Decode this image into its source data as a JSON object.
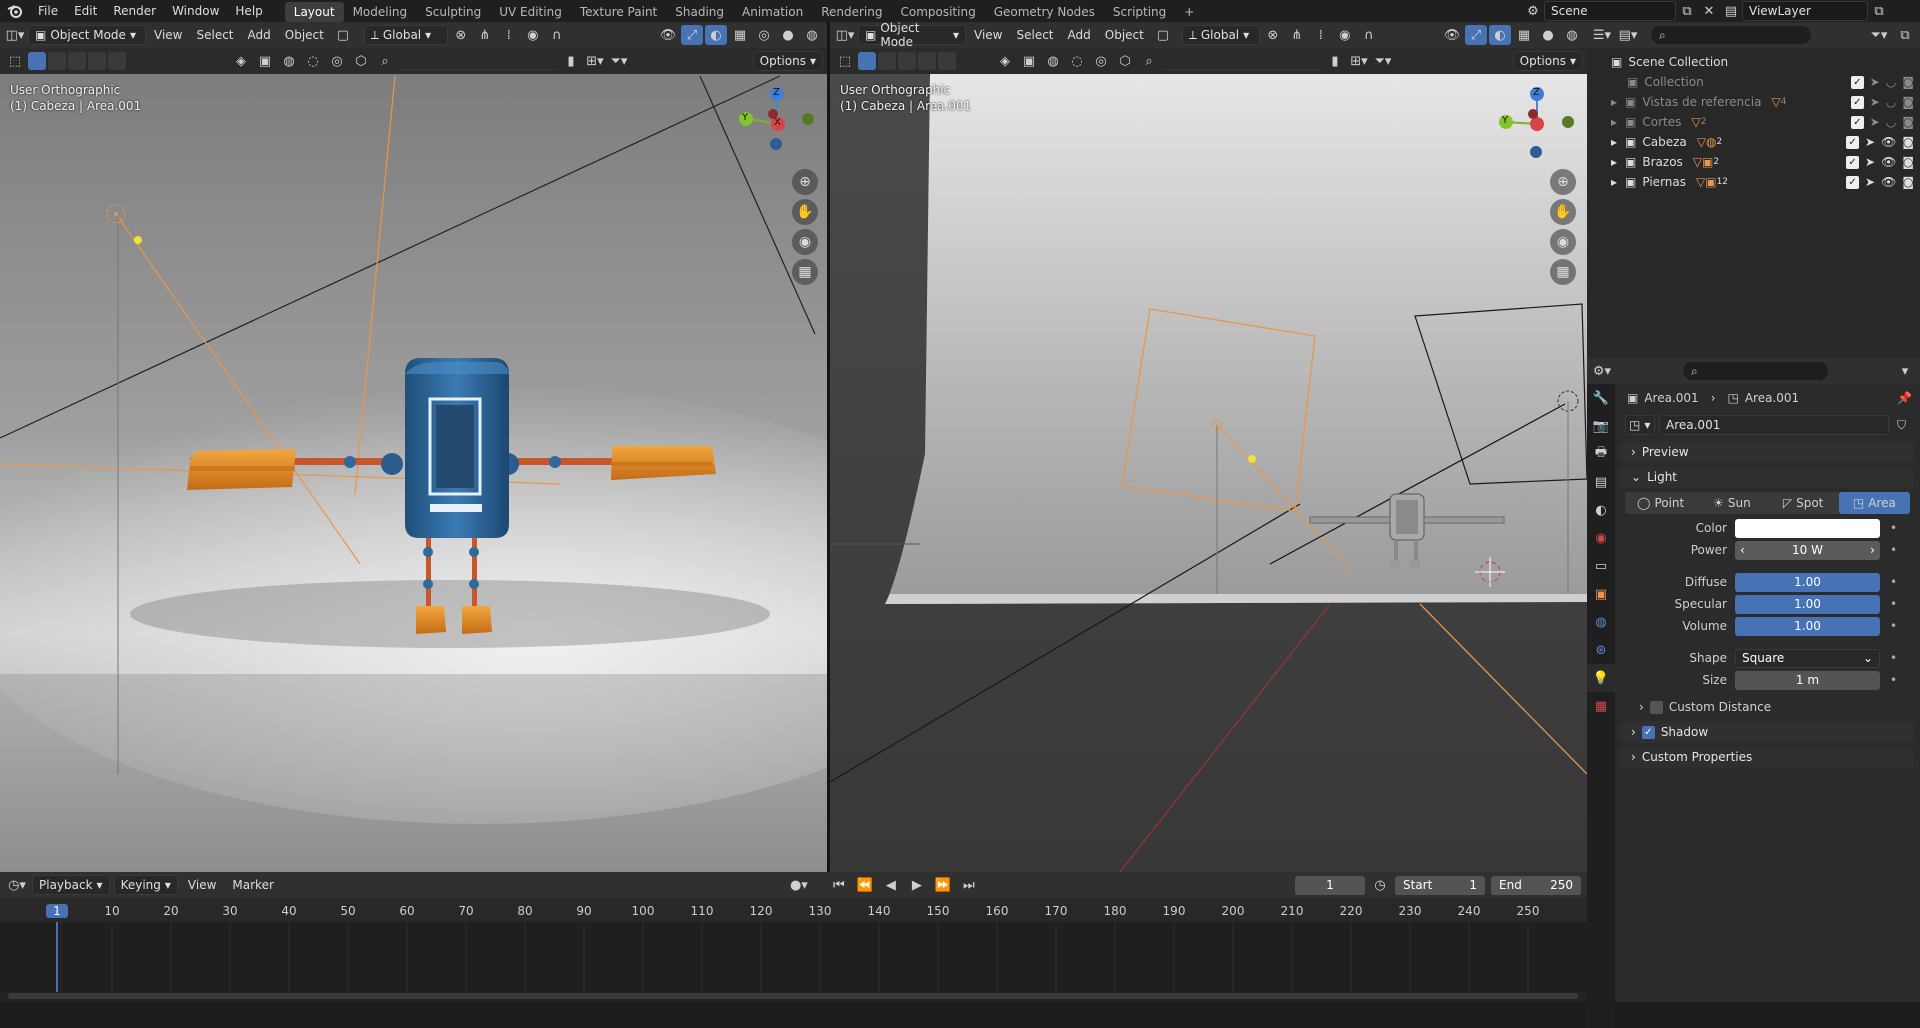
{
  "topbar": {
    "menus": [
      "File",
      "Edit",
      "Render",
      "Window",
      "Help"
    ],
    "workspaces": [
      "Layout",
      "Modeling",
      "Sculpting",
      "UV Editing",
      "Texture Paint",
      "Shading",
      "Animation",
      "Rendering",
      "Compositing",
      "Geometry Nodes",
      "Scripting"
    ],
    "active_workspace": "Layout",
    "add_tab": "+",
    "scene": "Scene",
    "view_layer": "ViewLayer"
  },
  "viewport_left": {
    "mode": "Object Mode",
    "menus": [
      "View",
      "Select",
      "Add",
      "Object"
    ],
    "transform": "Global",
    "options": "Options",
    "label_line1": "User Orthographic",
    "label_line2": "(1) Cabeza | Area.001"
  },
  "viewport_right": {
    "mode": "Object Mode",
    "menus": [
      "View",
      "Select",
      "Add",
      "Object"
    ],
    "transform": "Global",
    "options": "Options",
    "label_line1": "User Orthographic",
    "label_line2": "(1) Cabeza | Area.001"
  },
  "gizmo": {
    "x": "X",
    "y": "Y",
    "z": "Z"
  },
  "outliner": {
    "root": "Scene Collection",
    "items": [
      {
        "name": "Collection",
        "dim": true,
        "badge": ""
      },
      {
        "name": "Vistas de referencia",
        "dim": true,
        "badge": "4"
      },
      {
        "name": "Cortes",
        "dim": true,
        "badge": "2"
      },
      {
        "name": "Cabeza",
        "dim": false,
        "badge": "2"
      },
      {
        "name": "Brazos",
        "dim": false,
        "badge": "2"
      },
      {
        "name": "Piernas",
        "dim": false,
        "badge": "12"
      }
    ]
  },
  "properties": {
    "breadcrumb_object": "Area.001",
    "breadcrumb_data": "Area.001",
    "datablock": "Area.001",
    "panels": {
      "preview": "Preview",
      "light": "Light",
      "custom_distance": "Custom Distance",
      "shadow": "Shadow",
      "custom_properties": "Custom Properties"
    },
    "light_types": [
      "Point",
      "Sun",
      "Spot",
      "Area"
    ],
    "active_light_type": "Area",
    "color_label": "Color",
    "color_value": "#ffffff",
    "power_label": "Power",
    "power_value": "10 W",
    "diffuse_label": "Diffuse",
    "diffuse_value": "1.00",
    "specular_label": "Specular",
    "specular_value": "1.00",
    "volume_label": "Volume",
    "volume_value": "1.00",
    "shape_label": "Shape",
    "shape_value": "Square",
    "size_label": "Size",
    "size_value": "1 m"
  },
  "timeline": {
    "menus": [
      "Playback",
      "Keying",
      "View",
      "Marker"
    ],
    "current_frame": "1",
    "start_label": "Start",
    "start_value": "1",
    "end_label": "End",
    "end_value": "250",
    "ruler": [
      "1",
      "10",
      "20",
      "30",
      "40",
      "50",
      "60",
      "70",
      "80",
      "90",
      "100",
      "110",
      "120",
      "130",
      "140",
      "150",
      "160",
      "170",
      "180",
      "190",
      "200",
      "210",
      "220",
      "230",
      "240",
      "250"
    ]
  },
  "colors": {
    "accent": "#4772b3",
    "robot_body": "#2f6a9e",
    "robot_limbs": "#e08a2a",
    "light_outline": "#e8964a"
  }
}
